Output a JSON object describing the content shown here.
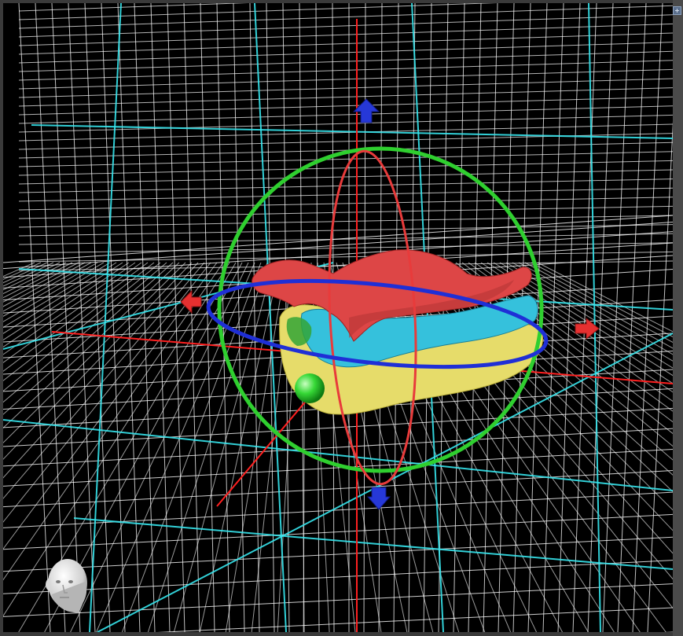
{
  "viewer": {
    "colors": {
      "background": "#000000",
      "grid_minor": "#ffffff",
      "grid_major": "#37e6ee",
      "axis_x": "#ff2020",
      "axis_y": "#ff2020",
      "ring_x": "#e83b3b",
      "ring_y": "#1f2fd6",
      "ring_z": "#2fcf2f",
      "model_upper": "#e04848",
      "model_lower": "#e8e070",
      "model_teeth": "#35c1dc",
      "handle_blue": "#2638d8",
      "handle_red": "#e63030",
      "handle_green": "#38d838"
    },
    "icons": {
      "view_orientation": "head-icon",
      "corner_menu": "grid-menu-icon"
    }
  }
}
